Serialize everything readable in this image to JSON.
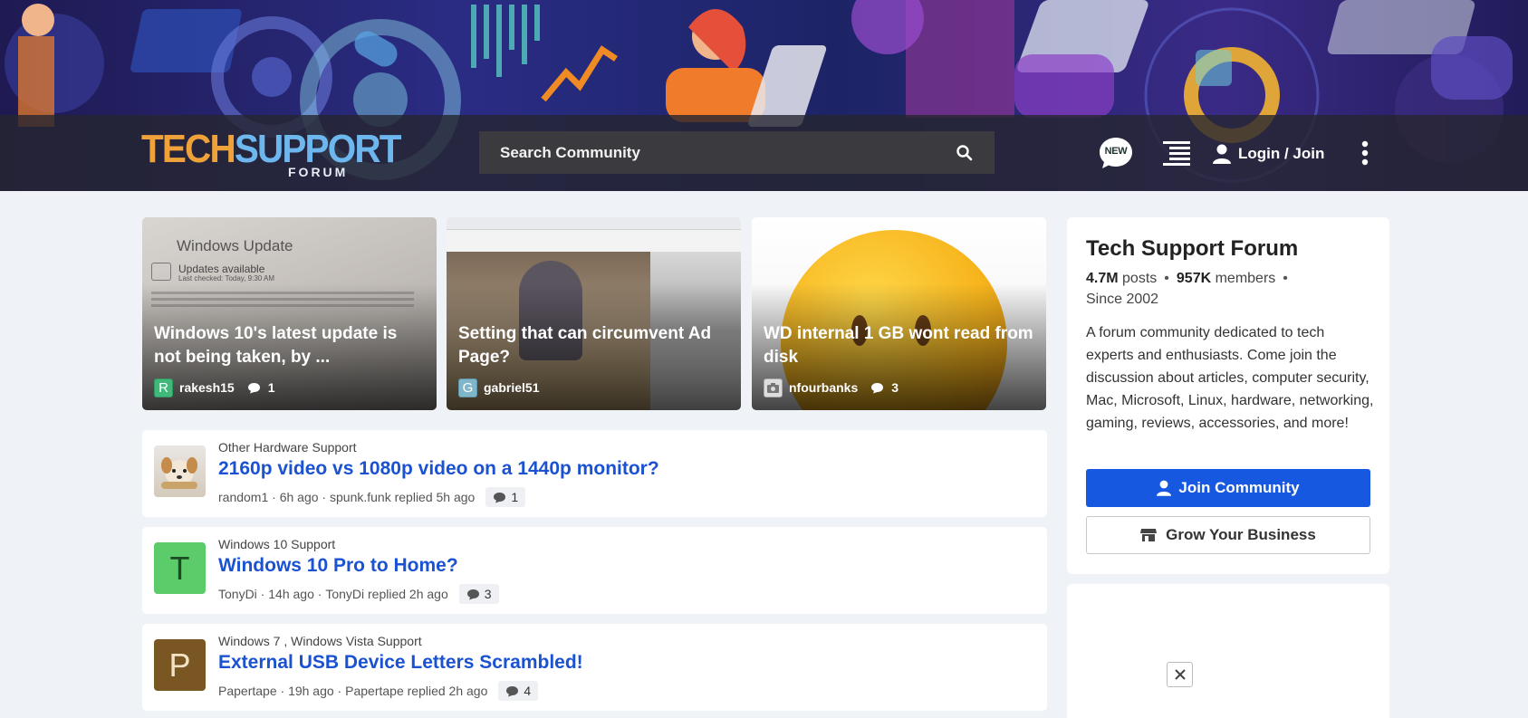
{
  "header": {
    "logo_tech": "TECH",
    "logo_support": "SUPPORT",
    "logo_forum": "FORUM",
    "search_placeholder": "Search Community",
    "new_badge": "NEW",
    "login_label": "Login / Join"
  },
  "featured": [
    {
      "title": "Windows 10's latest update is not being taken, by ...",
      "author": "rakesh15",
      "author_initial": "R",
      "replies": "1",
      "image_heading": "Windows Update",
      "image_line1": "Updates available",
      "image_line2": "Last checked: Today, 9:30 AM"
    },
    {
      "title": "Setting that can circumvent Ad Page?",
      "author": "gabriel51",
      "author_initial": "G"
    },
    {
      "title": "WD internal 1 GB wont read from disk",
      "author": "nfourbanks",
      "replies": "3"
    }
  ],
  "threads": [
    {
      "category": "Other Hardware Support",
      "title": "2160p video vs 1080p video on a 1440p monitor?",
      "author": "random1",
      "posted": "6h ago",
      "replied_by": "spunk.funk replied 5h ago",
      "replies": "1",
      "initial": ""
    },
    {
      "category": "Windows 10 Support",
      "title": "Windows 10 Pro to Home?",
      "author": "TonyDi",
      "posted": "14h ago",
      "replied_by": "TonyDi replied 2h ago",
      "replies": "3",
      "initial": "T"
    },
    {
      "category": "Windows 7 , Windows Vista Support",
      "title": "External USB Device Letters Scrambled!",
      "author": "Papertape",
      "posted": "19h ago",
      "replied_by": "Papertape replied 2h ago",
      "replies": "4",
      "initial": "P"
    }
  ],
  "sidebar": {
    "title": "Tech Support Forum",
    "posts_count": "4.7M",
    "posts_label": "posts",
    "members_count": "957K",
    "members_label": "members",
    "since": "Since 2002",
    "description": "A forum community dedicated to tech experts and enthusiasts. Come join the discussion about articles, computer security, Mac, Microsoft, Linux, hardware, networking, gaming, reviews, accessories, and more!",
    "join_label": "Join Community",
    "grow_label": "Grow Your Business"
  },
  "colors": {
    "primary": "#1758e1",
    "link": "#1a52d1",
    "logo_orange": "#f0a23a",
    "logo_blue": "#6db6ee",
    "avatar_green": "#5ccb6a",
    "avatar_brown": "#7a5722"
  },
  "icons": [
    "search-icon",
    "new-badge-icon",
    "list-icon",
    "user-icon",
    "more-vertical-icon",
    "chat-bubble-icon",
    "store-icon",
    "close-icon"
  ]
}
